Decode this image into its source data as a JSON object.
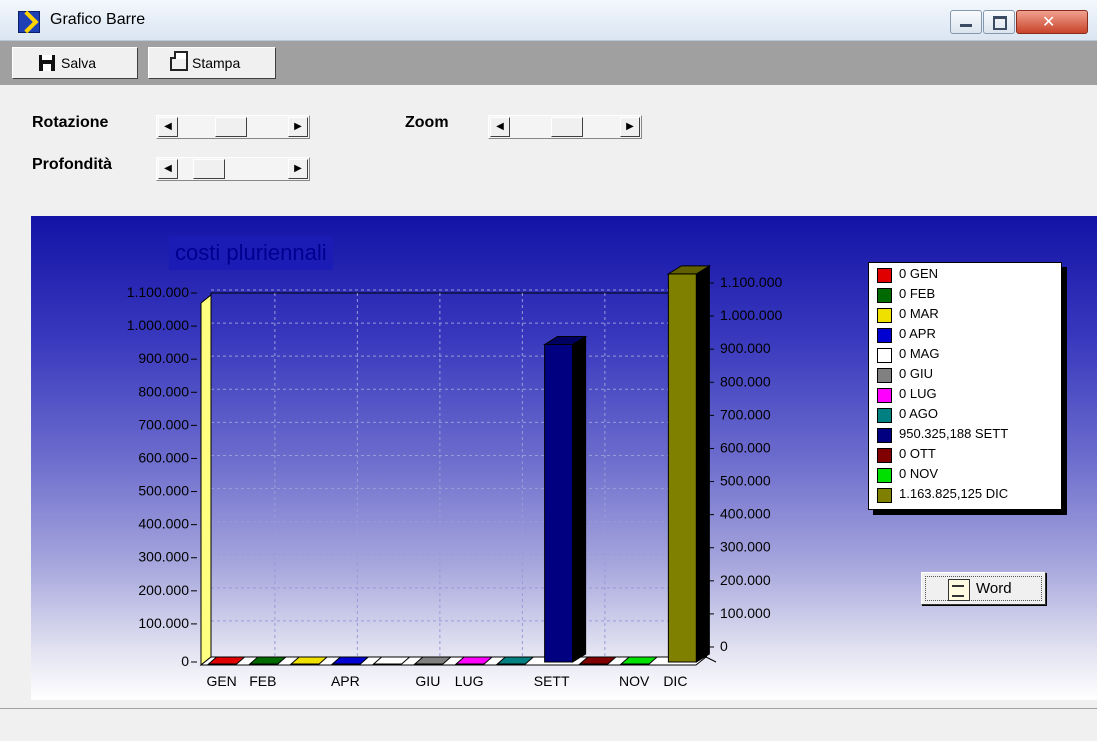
{
  "window": {
    "title": "Grafico Barre"
  },
  "toolbar": {
    "salva_label": "Salva",
    "stampa_label": "Stampa"
  },
  "controls": {
    "rotazione_label": "Rotazione",
    "zoom_label": "Zoom",
    "profondita_label": "Profondità"
  },
  "word_button": {
    "label": "Word"
  },
  "chart_data": {
    "type": "bar",
    "title": "costi pluriennali",
    "categories": [
      "GEN",
      "FEB",
      "MAR",
      "APR",
      "MAG",
      "GIU",
      "LUG",
      "AGO",
      "SETT",
      "OTT",
      "NOV",
      "DIC"
    ],
    "x_tick_labels": [
      "GEN",
      "FEB",
      "",
      "APR",
      "",
      "GIU",
      "LUG",
      "",
      "SETT",
      "",
      "NOV",
      "DIC"
    ],
    "values": [
      0,
      0,
      0,
      0,
      0,
      0,
      0,
      0,
      950325.188,
      0,
      0,
      1163825.125
    ],
    "colors": [
      "#e00000",
      "#006a00",
      "#f0e000",
      "#0000d0",
      "#ffffff",
      "#808080",
      "#ff00ff",
      "#008080",
      "#000080",
      "#800000",
      "#00e000",
      "#808000"
    ],
    "legend": [
      "0 GEN",
      "0 FEB",
      "0 MAR",
      "0 APR",
      "0 MAG",
      "0 GIU",
      "0 LUG",
      "0 AGO",
      "950.325,188 SETT",
      "0 OTT",
      "0 NOV",
      "1.163.825,125 DIC"
    ],
    "y_ticks": [
      0,
      100000,
      200000,
      300000,
      400000,
      500000,
      600000,
      700000,
      800000,
      900000,
      1000000,
      1100000
    ],
    "y_tick_labels": [
      "0",
      "100.000",
      "200.000",
      "300.000",
      "400.000",
      "500.000",
      "600.000",
      "700.000",
      "800.000",
      "900.000",
      "1.000.000",
      "1.100.000"
    ],
    "ylim": [
      0,
      1100000
    ],
    "grid": true,
    "legend_position": "right",
    "wall_color": "#ffff80"
  }
}
